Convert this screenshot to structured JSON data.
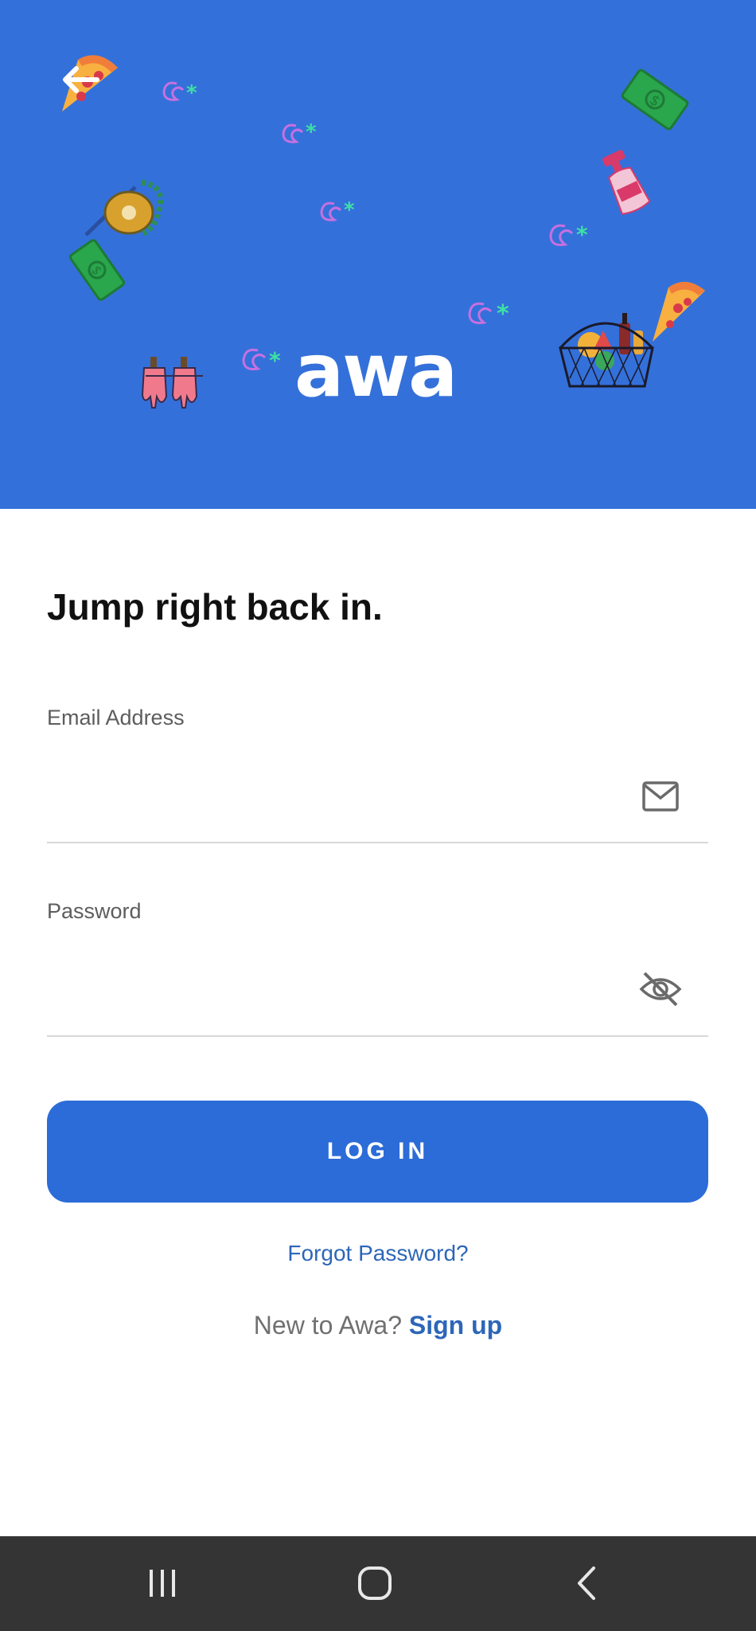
{
  "app": {
    "logo_text": "awa"
  },
  "login": {
    "heading": "Jump right back in.",
    "email_label": "Email Address",
    "email_value": "",
    "password_label": "Password",
    "password_value": "",
    "login_button": "LOG IN",
    "forgot_password": "Forgot Password?",
    "signup_prompt": "New to Awa?",
    "signup_link": "Sign up"
  },
  "icons": {
    "back": "back-arrow-icon",
    "email": "mail-icon",
    "password": "eye-off-icon"
  },
  "colors": {
    "hero_background": "#3470da",
    "primary_button": "#2c6cd8",
    "link": "#2d66b8",
    "system_nav": "#343434"
  }
}
